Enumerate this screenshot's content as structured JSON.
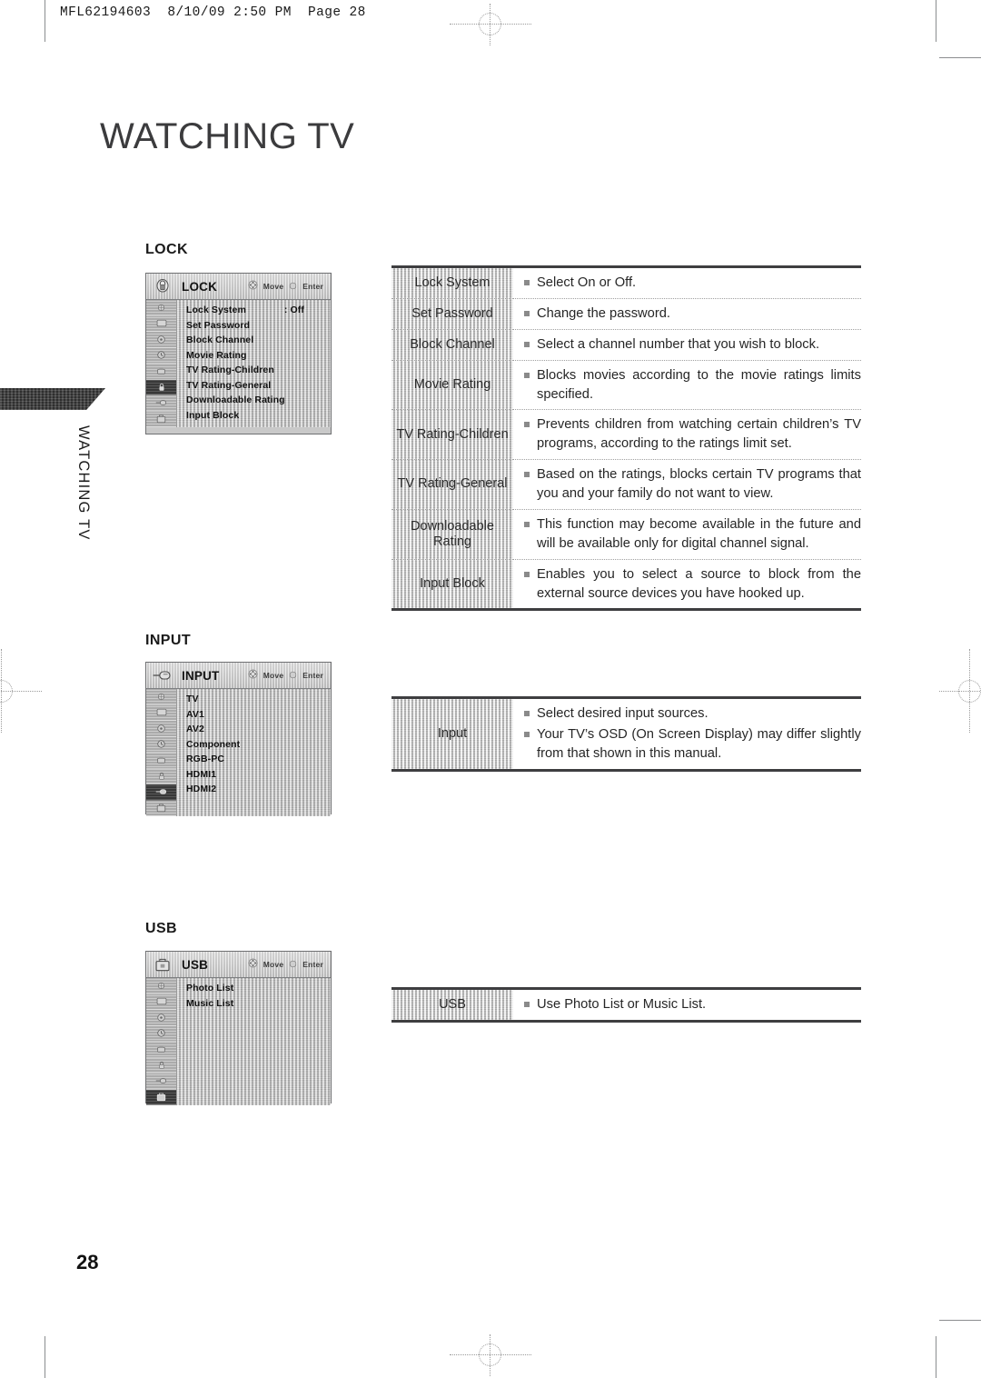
{
  "page": {
    "slug": "MFL62194603  8/10/09 2:50 PM  Page 28",
    "chapter_title": "WATCHING TV",
    "side_tab_text": "WATCHING TV",
    "page_number": "28"
  },
  "sections": {
    "lock": {
      "caption": "LOCK",
      "osd": {
        "title": "LOCK",
        "move_label": "Move",
        "enter_label": "Enter",
        "head_icon": "lock-icon",
        "rail_icons": [
          "picture-icon",
          "screen-icon",
          "audio-icon",
          "time-icon",
          "option-icon",
          "lock-icon",
          "input-icon",
          "usb-icon"
        ],
        "selected_rail_index": 5,
        "items": [
          {
            "label": "Lock System",
            "value": ": Off"
          },
          {
            "label": "Set Password",
            "value": ""
          },
          {
            "label": "Block Channel",
            "value": ""
          },
          {
            "label": "Movie Rating",
            "value": ""
          },
          {
            "label": "TV Rating-Children",
            "value": ""
          },
          {
            "label": "TV Rating-General",
            "value": ""
          },
          {
            "label": "Downloadable Rating",
            "value": ""
          },
          {
            "label": "Input Block",
            "value": ""
          }
        ]
      },
      "rows": [
        {
          "label": "Lock System",
          "lines": [
            "Select On or Off."
          ]
        },
        {
          "label": "Set Password",
          "lines": [
            "Change the password."
          ]
        },
        {
          "label": "Block Channel",
          "lines": [
            "Select a channel number that you wish to block."
          ]
        },
        {
          "label": "Movie Rating",
          "lines": [
            "Blocks movies according to the movie ratings limits specified."
          ]
        },
        {
          "label": "TV Rating-Children",
          "lines": [
            "Prevents children from watching certain children’s TV programs, according to the ratings limit set."
          ]
        },
        {
          "label": "TV Rating-General",
          "lines": [
            "Based on the ratings, blocks certain TV programs that you and your family do not want to view."
          ]
        },
        {
          "label": "Downloadable Rating",
          "lines": [
            "This function may become available in the future and will be available only for digital channel signal."
          ]
        },
        {
          "label": "Input Block",
          "lines": [
            "Enables you to select a source to block from the external source devices you have hooked up."
          ]
        }
      ]
    },
    "input": {
      "caption": "INPUT",
      "osd": {
        "title": "INPUT",
        "move_label": "Move",
        "enter_label": "Enter",
        "head_icon": "input-icon",
        "rail_icons": [
          "picture-icon",
          "screen-icon",
          "audio-icon",
          "time-icon",
          "option-icon",
          "lock-icon",
          "input-icon",
          "usb-icon"
        ],
        "selected_rail_index": 6,
        "items": [
          {
            "label": "TV",
            "value": ""
          },
          {
            "label": "AV1",
            "value": ""
          },
          {
            "label": "AV2",
            "value": ""
          },
          {
            "label": "Component",
            "value": ""
          },
          {
            "label": "RGB-PC",
            "value": ""
          },
          {
            "label": "HDMI1",
            "value": ""
          },
          {
            "label": "HDMI2",
            "value": ""
          }
        ]
      },
      "rows": [
        {
          "label": "Input",
          "lines": [
            "Select desired input sources.",
            "Your TV’s OSD (On Screen Display) may differ slightly from that shown in this manual."
          ]
        }
      ]
    },
    "usb": {
      "caption": "USB",
      "osd": {
        "title": "USB",
        "move_label": "Move",
        "enter_label": "Enter",
        "head_icon": "usb-icon",
        "rail_icons": [
          "picture-icon",
          "screen-icon",
          "audio-icon",
          "time-icon",
          "option-icon",
          "lock-icon",
          "input-icon",
          "usb-icon"
        ],
        "selected_rail_index": 7,
        "items": [
          {
            "label": "Photo List",
            "value": ""
          },
          {
            "label": "Music List",
            "value": ""
          }
        ]
      },
      "rows": [
        {
          "label": "USB",
          "lines": [
            "Use Photo List or Music List."
          ]
        }
      ]
    }
  },
  "colors": {
    "ink": "#231f20",
    "rule": "#3e3e40",
    "panel_gray": "#c4c4c4",
    "label_gray": "#d3d3d3",
    "bullet": "#8a8a8a",
    "tab_dark": "#3a3a3a"
  }
}
